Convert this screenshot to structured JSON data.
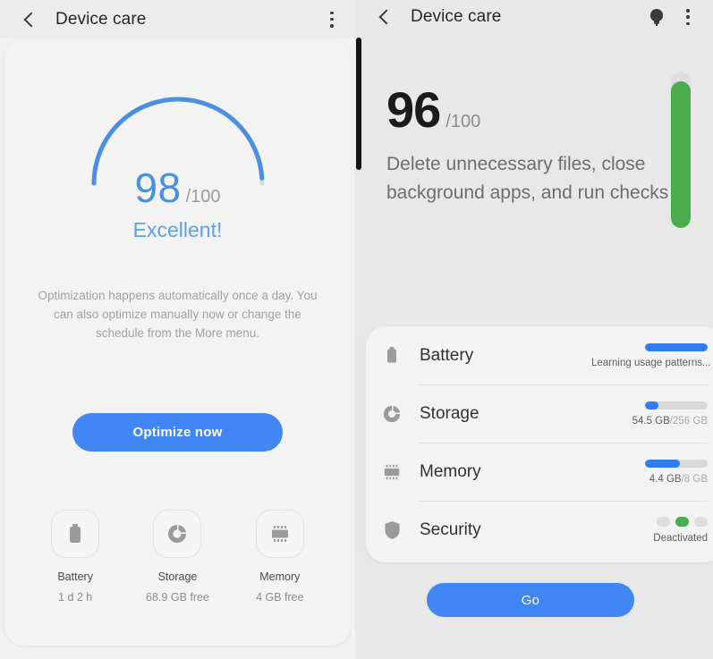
{
  "left": {
    "appbar": {
      "title": "Device care",
      "back_icon": "back-arrow-icon",
      "menu_icon": "more-options-icon"
    },
    "gauge": {
      "score": "98",
      "denominator": "/100",
      "label": "Excellent!",
      "value": 98,
      "arc_color": "#4a8fe0"
    },
    "description": "Optimization happens automatically once a day. You can also optimize manually now or change the schedule from the More menu.",
    "optimize_button": "Optimize now",
    "quick_items": [
      {
        "icon": "battery-icon",
        "name": "Battery",
        "value": "1 d 2 h"
      },
      {
        "icon": "storage-pie-icon",
        "name": "Storage",
        "value": "68.9 GB free"
      },
      {
        "icon": "memory-chip-icon",
        "name": "Memory",
        "value": "4 GB free"
      }
    ]
  },
  "right": {
    "appbar": {
      "title": "Device care",
      "back_icon": "back-arrow-icon",
      "tips_icon": "lightbulb-icon",
      "menu_icon": "more-options-icon"
    },
    "score": {
      "value": "96",
      "denominator": "/100",
      "description": "Delete unnecessary files, close background apps, and run checks",
      "bar_percent": 94,
      "bar_color": "#4aac4c"
    },
    "items": [
      {
        "icon": "battery-icon",
        "label": "Battery",
        "meter_percent": 100,
        "status": "Learning usage patterns...",
        "status_used": "Learning usage patterns...",
        "status_total": ""
      },
      {
        "icon": "storage-pie-icon",
        "label": "Storage",
        "meter_percent": 21,
        "status": "54.5 GB/256 GB",
        "status_used": "54.5 GB",
        "status_total": "/256 GB"
      },
      {
        "icon": "memory-chip-icon",
        "label": "Memory",
        "meter_percent": 55,
        "status": "4.4 GB/8 GB",
        "status_used": "4.4 GB",
        "status_total": "/8 GB"
      },
      {
        "icon": "shield-icon",
        "label": "Security",
        "meter_percent": 0,
        "status": "Deactivated",
        "status_used": "Deactivated",
        "status_total": ""
      }
    ],
    "go_button": "Go"
  }
}
